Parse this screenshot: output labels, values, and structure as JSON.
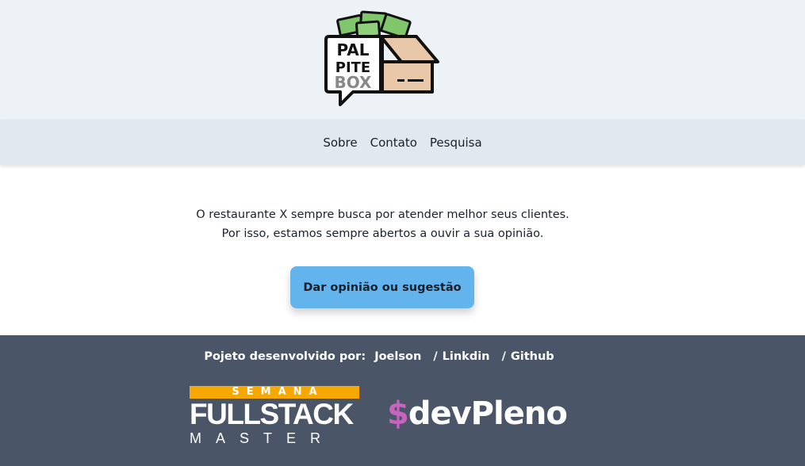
{
  "logo": {
    "line1": "PAL",
    "line2": "PITE",
    "line3": "BOX"
  },
  "nav": {
    "items": [
      "Sobre",
      "Contato",
      "Pesquisa"
    ]
  },
  "main": {
    "intro_line1": "O restaurante X sempre busca por atender melhor seus clientes.",
    "intro_line2": "Por isso, estamos sempre abertos a ouvir a sua opinião.",
    "cta_label": "Dar opinião ou sugestão"
  },
  "footer": {
    "credit_prefix": "Pojeto desenvolvido por:",
    "author": "Joelson",
    "separator": "/",
    "linkedin": "Linkdin",
    "github": "Github",
    "fsm_top": "SEMANA",
    "fsm_main": "FULLSTACK",
    "fsm_bottom": "MASTER",
    "devpleno_symbol": "$",
    "devpleno_text": "devPleno"
  },
  "colors": {
    "header_bg": "#edf2f7",
    "nav_bg": "#e2e8f0",
    "cta_bg": "#63b3ed",
    "footer_bg": "#4a5568",
    "fsm_orange": "#f6a800",
    "devpleno_pink": "#c764bd"
  }
}
